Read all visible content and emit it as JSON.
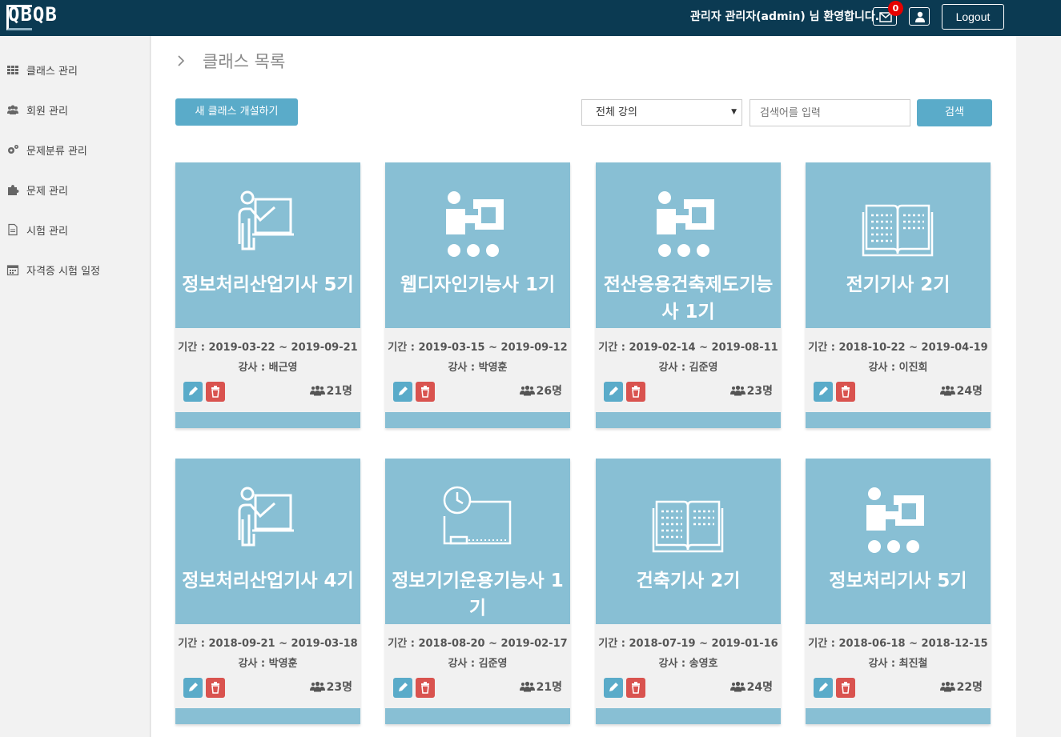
{
  "header": {
    "logo_text": "QBQB",
    "welcome": "관리자 관리자(admin) 님 환영합니다.",
    "mail_count": "0",
    "logout_label": "Logout"
  },
  "sidebar": {
    "items": [
      {
        "label": "클래스 관리",
        "icon": "grid-icon"
      },
      {
        "label": "회원 관리",
        "icon": "users-icon"
      },
      {
        "label": "문제분류 관리",
        "icon": "gears-icon"
      },
      {
        "label": "문제 관리",
        "icon": "puzzle-icon"
      },
      {
        "label": "시험 관리",
        "icon": "file-icon"
      },
      {
        "label": "자격증 시험 일정",
        "icon": "calendar-icon"
      }
    ]
  },
  "main": {
    "title": "클래스 목록",
    "new_class_label": "새 클래스 개설하기",
    "filter_selected": "전체 강의",
    "search_placeholder": "검색어를 입력",
    "search_label": "검색"
  },
  "cards": [
    {
      "title": "정보처리산업기사 5기",
      "period": "기간 : 2019-03-22 ~ 2019-09-21",
      "teacher": "강사 : 배근영",
      "count": "21명",
      "icon": "teacher-board-icon"
    },
    {
      "title": "웹디자인기능사 1기",
      "period": "기간 : 2019-03-15 ~ 2019-09-12",
      "teacher": "강사 : 박영훈",
      "count": "26명",
      "icon": "presenter-icon"
    },
    {
      "title": "전산응용건축제도기능사 1기",
      "period": "기간 : 2019-02-14 ~ 2019-08-11",
      "teacher": "강사 : 김준영",
      "count": "23명",
      "icon": "presenter-icon"
    },
    {
      "title": "전기기사 2기",
      "period": "기간 : 2018-10-22 ~ 2019-04-19",
      "teacher": "강사 : 이진회",
      "count": "24명",
      "icon": "open-book-icon"
    },
    {
      "title": "정보처리산업기사 4기",
      "period": "기간 : 2018-09-21 ~ 2019-03-18",
      "teacher": "강사 : 박영훈",
      "count": "23명",
      "icon": "teacher-board-icon"
    },
    {
      "title": "정보기기운용기능사 1기",
      "period": "기간 : 2018-08-20 ~ 2019-02-17",
      "teacher": "강사 : 김준영",
      "count": "21명",
      "icon": "clock-board-icon"
    },
    {
      "title": "건축기사 2기",
      "period": "기간 : 2018-07-19 ~ 2019-01-16",
      "teacher": "강사 : 송영호",
      "count": "24명",
      "icon": "open-book-icon"
    },
    {
      "title": "정보처리기사 5기",
      "period": "기간 : 2018-06-18 ~ 2018-12-15",
      "teacher": "강사 : 최진철",
      "count": "22명",
      "icon": "presenter-icon"
    }
  ],
  "colors": {
    "topbar": "#0b3a52",
    "accent": "#5aabc9",
    "card_banner": "#88bfd4",
    "danger": "#d9534f"
  }
}
